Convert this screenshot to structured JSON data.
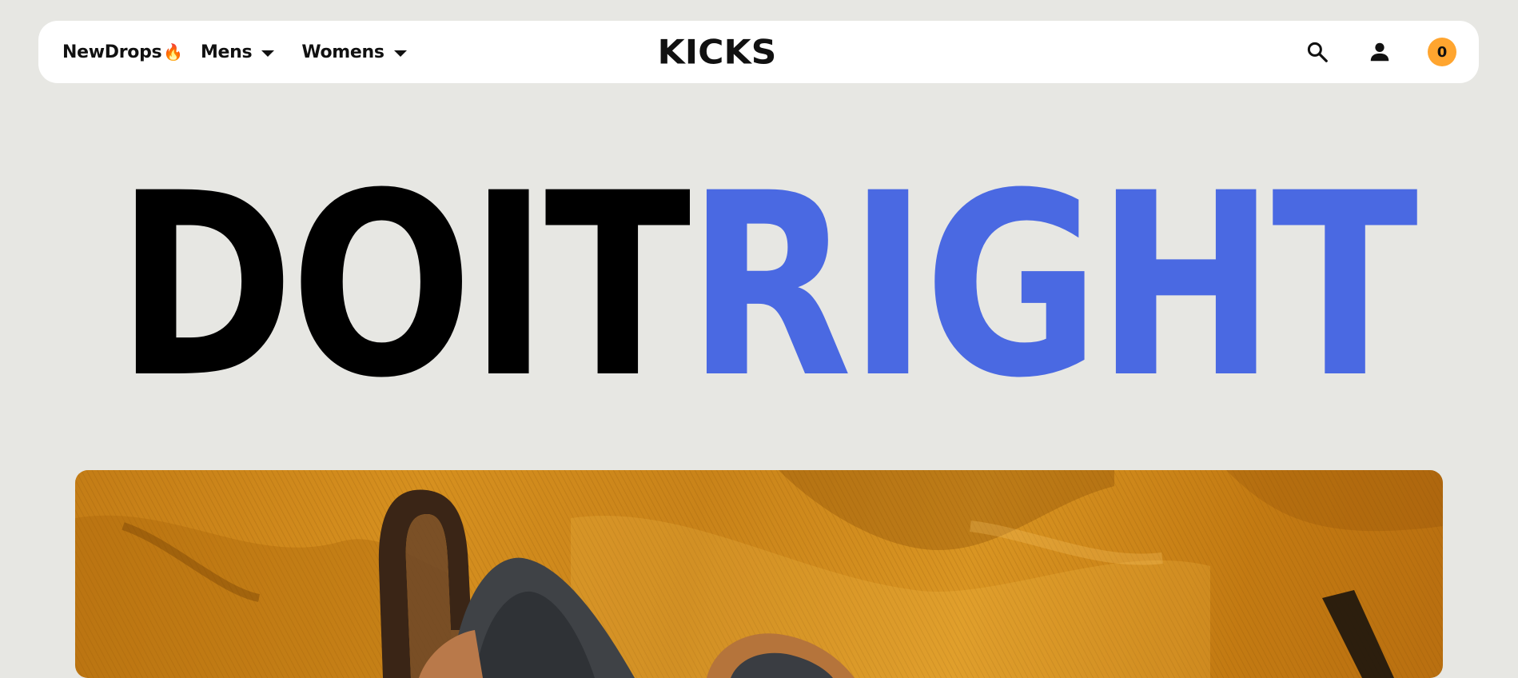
{
  "nav": {
    "new_drops": "NewDrops",
    "new_drops_icon": "fire-emoji",
    "mens": "Mens",
    "womens": "Womens",
    "logo": "KICKS",
    "cart_count": "0",
    "icons": {
      "search": "search-icon",
      "user": "user-icon",
      "dropdown": "caret-down-icon"
    }
  },
  "hero": {
    "part1": "DOIT",
    "part2": "RIGHT"
  },
  "colors": {
    "background": "#e7e7e3",
    "accent_blue": "#4a69e2",
    "accent_yellow": "#ffa52f",
    "text_dark": "#111111",
    "image_mustard": "#d38d1e"
  }
}
